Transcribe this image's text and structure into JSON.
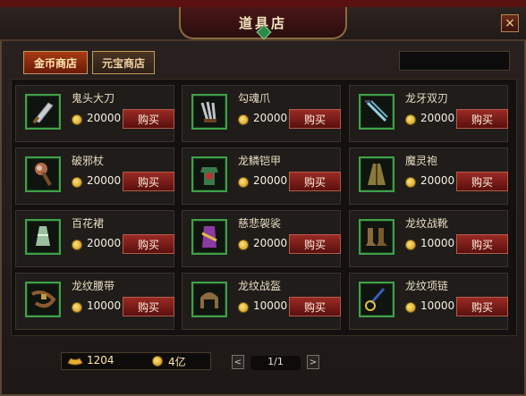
{
  "window": {
    "title": "道具店",
    "close_label": "×"
  },
  "tabs": [
    {
      "label": "金币商店",
      "active": true
    },
    {
      "label": "元宝商店",
      "active": false
    }
  ],
  "items": [
    {
      "name": "鬼头大刀",
      "price": "20000",
      "buy_label": "购买",
      "icon": "broadsword-icon"
    },
    {
      "name": "勾魂爪",
      "price": "20000",
      "buy_label": "购买",
      "icon": "claw-icon"
    },
    {
      "name": "龙牙双刃",
      "price": "20000",
      "buy_label": "购买",
      "icon": "twin-blades-icon"
    },
    {
      "name": "破邪杖",
      "price": "20000",
      "buy_label": "购买",
      "icon": "staff-icon"
    },
    {
      "name": "龙鳞铠甲",
      "price": "20000",
      "buy_label": "购买",
      "icon": "armor-icon"
    },
    {
      "name": "魔灵袍",
      "price": "20000",
      "buy_label": "购买",
      "icon": "robe-icon"
    },
    {
      "name": "百花裙",
      "price": "20000",
      "buy_label": "购买",
      "icon": "skirt-icon"
    },
    {
      "name": "慈悲袈裟",
      "price": "20000",
      "buy_label": "购买",
      "icon": "cassock-icon"
    },
    {
      "name": "龙纹战靴",
      "price": "10000",
      "buy_label": "购买",
      "icon": "boots-icon"
    },
    {
      "name": "龙纹腰带",
      "price": "10000",
      "buy_label": "购买",
      "icon": "belt-icon"
    },
    {
      "name": "龙纹战盔",
      "price": "10000",
      "buy_label": "购买",
      "icon": "helmet-icon"
    },
    {
      "name": "龙纹项链",
      "price": "10000",
      "buy_label": "购买",
      "icon": "necklace-icon"
    }
  ],
  "currency": {
    "ingot_amount": "1204",
    "coin_amount": "4亿"
  },
  "pagination": {
    "label": "1/1",
    "prev": "<",
    "next": ">"
  },
  "colors": {
    "accent_red": "#8a1e1a",
    "icon_border_green": "#3fa04a",
    "gold": "#ffe7a0"
  }
}
